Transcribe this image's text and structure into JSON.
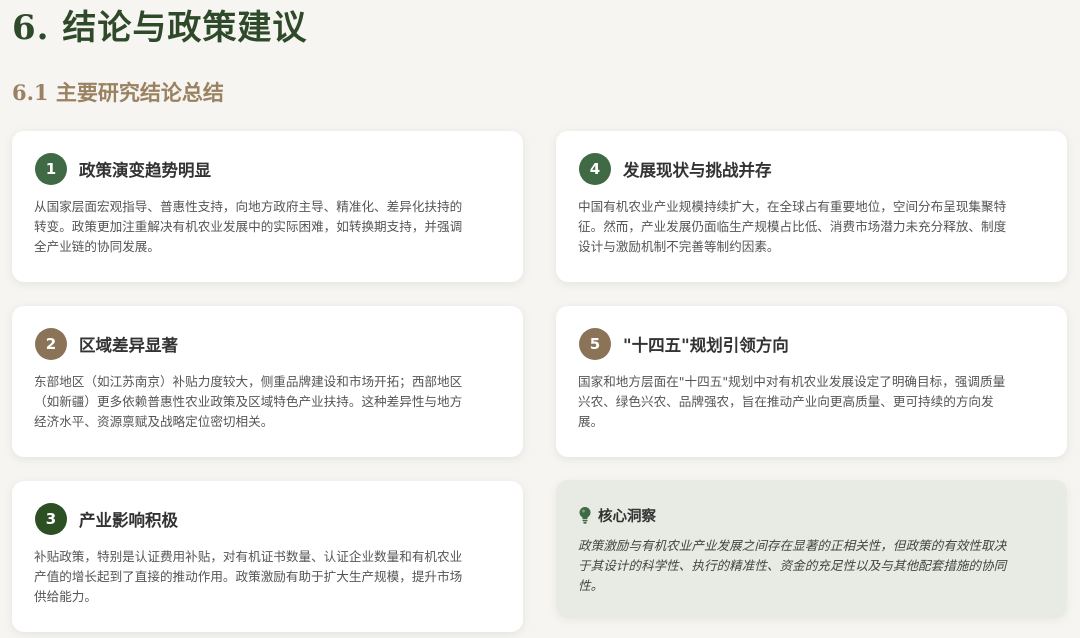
{
  "page": {
    "title": "6. 结论与政策建议",
    "section": "6.1 主要研究结论总结"
  },
  "colors": {
    "title_green": "#2f4a2a",
    "section_brown": "#9a8161",
    "badge_green": "#3f6a44",
    "badge_brown": "#8b7358",
    "badge_dark_green": "#2c4f23",
    "insight_bg": "#e7ebe3"
  },
  "cards": [
    {
      "number": "1",
      "title": "政策演变趋势明显",
      "lines": [
        "从国家层面宏观指导、普惠性支持，向地方政府主导、精准化、差异化扶持的",
        "转变。政策更加注重解决有机农业发展中的实际困难，如转换期支持，并强调",
        "全产业链的协同发展。"
      ]
    },
    {
      "number": "2",
      "title": "区域差异显著",
      "lines": [
        "东部地区（如江苏南京）补贴力度较大，侧重品牌建设和市场开拓；西部地区",
        "（如新疆）更多依赖普惠性农业政策及区域特色产业扶持。这种差异性与地方",
        "经济水平、资源禀赋及战略定位密切相关。"
      ]
    },
    {
      "number": "3",
      "title": "产业影响积极",
      "lines": [
        "补贴政策，特别是认证费用补贴，对有机证书数量、认证企业数量和有机农业",
        "产值的增长起到了直接的推动作用。政策激励有助于扩大生产规模，提升市场",
        "供给能力。"
      ]
    },
    {
      "number": "4",
      "title": "发展现状与挑战并存",
      "lines": [
        "中国有机农业产业规模持续扩大，在全球占有重要地位，空间分布呈现集聚特",
        "征。然而，产业发展仍面临生产规模占比低、消费市场潜力未充分释放、制度",
        "设计与激励机制不完善等制约因素。"
      ]
    },
    {
      "number": "5",
      "title": "\"十四五\"规划引领方向",
      "lines": [
        "国家和地方层面在\"十四五\"规划中对有机农业发展设定了明确目标，强调质量",
        "兴农、绿色兴农、品牌强农，旨在推动产业向更高质量、更可持续的方向发",
        "展。"
      ]
    }
  ],
  "insight": {
    "icon": "lightbulb-icon",
    "title": "核心洞察",
    "lines": [
      "政策激励与有机农业产业发展之间存在显著的正相关性，但政策的有效性取决",
      "于其设计的科学性、执行的精准性、资金的充足性以及与其他配套措施的协同",
      "性。"
    ]
  }
}
